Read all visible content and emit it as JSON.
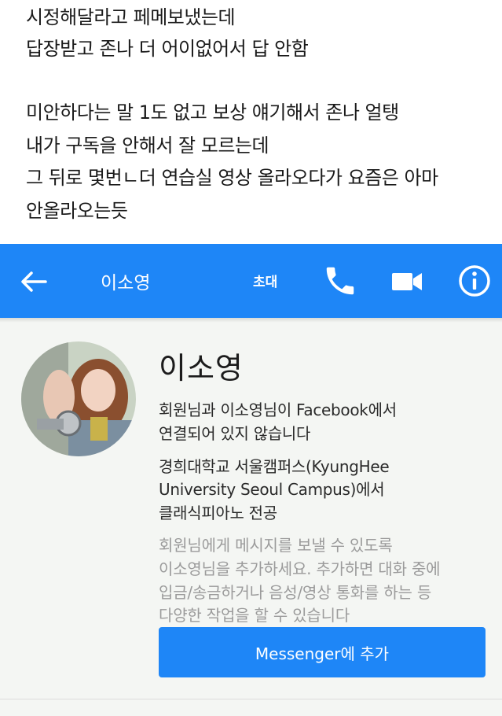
{
  "post": {
    "lines": [
      "시정해달라고 페메보냈는데",
      "답장받고 존나 더 어이없어서 답 안함",
      "미안하다는 말 1도 없고 보상 얘기해서 존나 얼탱",
      "내가 구독을 안해서 잘 모르는데",
      "그 뒤로 몇번ㄴ더 연습실 영상 올라오다가 요즘은 아마",
      "안올라오는듯"
    ]
  },
  "header": {
    "title": "이소영",
    "invite_label": "초대",
    "color": "#1e86f7",
    "icons": [
      "back-arrow-icon",
      "phone-icon",
      "video-camera-icon",
      "info-icon"
    ]
  },
  "profile": {
    "name": "이소영",
    "connection": [
      "회원님과 이소영님이 Facebook에서",
      "연결되어 있지 않습니다"
    ],
    "education": [
      "경희대학교 서울캠퍼스(KyungHee",
      "University Seoul Campus)에서",
      "클래식피아노 전공"
    ],
    "notice": [
      "회원님에게 메시지를 보낼 수 있도록",
      "이소영님을 추가하세요. 추가하면 대화 중에",
      "입금/송금하거나 음성/영상 통화를 하는 등",
      "다양한 작업을 할 수 있습니다"
    ],
    "add_button_label": "Messenger에 추가"
  }
}
